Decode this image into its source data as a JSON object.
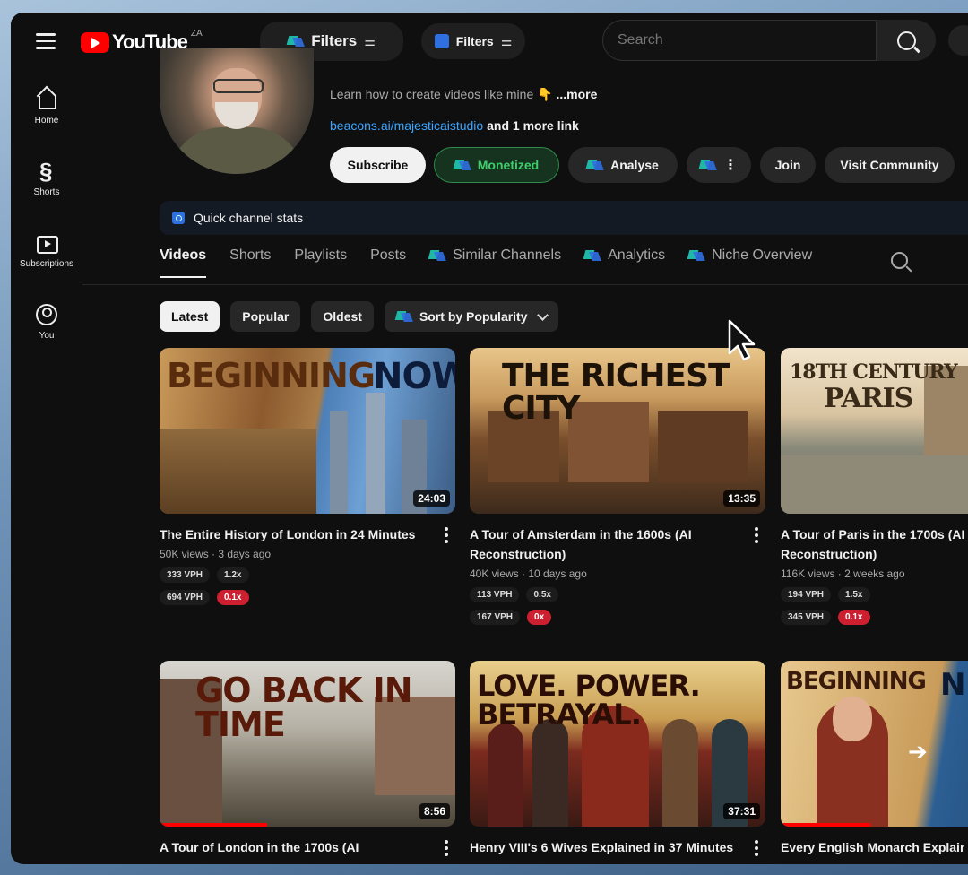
{
  "topbar": {
    "logo_text": "YouTube",
    "region": "ZA",
    "filters_big": "Filters",
    "filters_small": "Filters",
    "search_placeholder": "Search"
  },
  "sidebar": {
    "items": [
      {
        "label": "Home",
        "icon": "home-icon"
      },
      {
        "label": "Shorts",
        "icon": "shorts-icon"
      },
      {
        "label": "Subscriptions",
        "icon": "subscriptions-icon"
      },
      {
        "label": "You",
        "icon": "you-icon"
      }
    ]
  },
  "channel": {
    "description": "Learn how to create videos like mine 👇",
    "more": "...more",
    "link": "beacons.ai/majesticaistudio",
    "more_links": "and 1 more link",
    "buttons": {
      "subscribe": "Subscribe",
      "monetized": "Monetized",
      "analyse": "Analyse",
      "join": "Join",
      "visit_community": "Visit Community"
    },
    "quick_stats": "Quick channel stats"
  },
  "tabs": [
    "Videos",
    "Shorts",
    "Playlists",
    "Posts",
    "Similar Channels",
    "Analytics",
    "Niche Overview"
  ],
  "chips": {
    "latest": "Latest",
    "popular": "Popular",
    "oldest": "Oldest",
    "sort": "Sort by Popularity"
  },
  "videos": [
    {
      "thumb_a": "BEGINNING",
      "thumb_b": "NOW",
      "duration": "24:03",
      "title": "The Entire History of London in 24 Minutes",
      "meta": "50K views · 3 days ago",
      "vph1": "333 VPH",
      "x1": "1.2x",
      "vph2": "694 VPH",
      "x2": "0.1x"
    },
    {
      "thumb_a": "THE RICHEST CITY",
      "thumb_b": "",
      "duration": "13:35",
      "title": "A Tour of Amsterdam in the 1600s (AI Reconstruction)",
      "meta": "40K views · 10 days ago",
      "vph1": "113 VPH",
      "x1": "0.5x",
      "vph2": "167 VPH",
      "x2": "0x"
    },
    {
      "thumb_a": "18TH CENTURY",
      "thumb_b": "PARIS",
      "duration": "",
      "title": "A Tour of Paris in the 1700s (AI Reconstruction)",
      "meta": "116K views · 2 weeks ago",
      "vph1": "194 VPH",
      "x1": "1.5x",
      "vph2": "345 VPH",
      "x2": "0.1x"
    },
    {
      "thumb_a": "GO BACK IN TIME",
      "thumb_b": "",
      "duration": "8:56",
      "title": "A Tour of London in the 1700s (AI",
      "meta": "",
      "vph1": "",
      "x1": "",
      "vph2": "",
      "x2": ""
    },
    {
      "thumb_a": "LOVE. POWER. BETRAYAL.",
      "thumb_b": "",
      "duration": "37:31",
      "title": "Henry VIII's 6 Wives Explained in 37 Minutes",
      "meta": "",
      "vph1": "",
      "x1": "",
      "vph2": "",
      "x2": ""
    },
    {
      "thumb_a": "BEGINNING",
      "thumb_b": "N",
      "duration": "",
      "title": "Every English Monarch Explaine",
      "meta": "",
      "vph1": "",
      "x1": "",
      "vph2": "",
      "x2": ""
    }
  ],
  "colors": {
    "background": "#0f0f0f",
    "accent_red": "#ff0000",
    "link_blue": "#3ea6ff",
    "monetized_green": "#3ecf6c",
    "badge_red": "#cc1f2f"
  }
}
